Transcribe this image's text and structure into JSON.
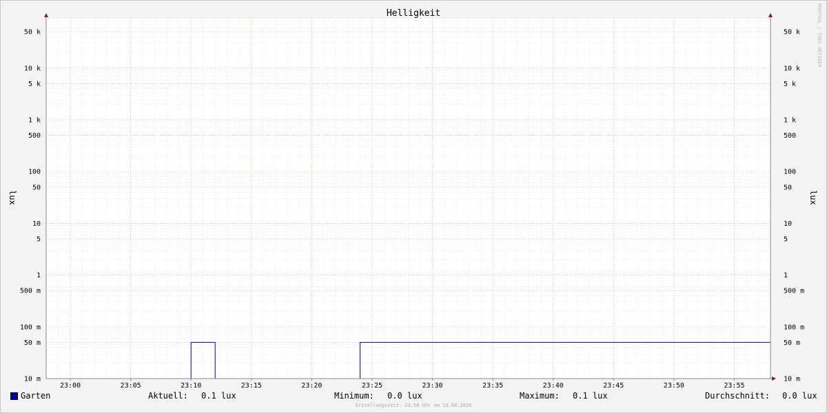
{
  "chart_data": {
    "type": "line",
    "title": "Helligkeit",
    "ylabel": "lux",
    "yscale": "log",
    "ylim": [
      0.01,
      90000
    ],
    "xlim": [
      "22:58",
      "23:58"
    ],
    "x_ticks": [
      "23:00",
      "23:05",
      "23:10",
      "23:15",
      "23:20",
      "23:25",
      "23:30",
      "23:35",
      "23:40",
      "23:45",
      "23:50",
      "23:55"
    ],
    "y_ticks": [
      {
        "value": 50000,
        "label": "50 k"
      },
      {
        "value": 10000,
        "label": "10 k"
      },
      {
        "value": 5000,
        "label": "5 k"
      },
      {
        "value": 1000,
        "label": "1 k"
      },
      {
        "value": 500,
        "label": "500"
      },
      {
        "value": 100,
        "label": "100"
      },
      {
        "value": 50,
        "label": "50"
      },
      {
        "value": 10,
        "label": "10"
      },
      {
        "value": 5,
        "label": "5"
      },
      {
        "value": 1,
        "label": "1"
      },
      {
        "value": 0.5,
        "label": "500 m"
      },
      {
        "value": 0.1,
        "label": "100 m"
      },
      {
        "value": 0.05,
        "label": "50 m"
      },
      {
        "value": 0.01,
        "label": "10 m"
      }
    ],
    "grid": true,
    "series": [
      {
        "name": "Garten",
        "color": "#0000a0",
        "x": [
          "22:58",
          "23:10",
          "23:10",
          "23:12",
          "23:12",
          "23:24",
          "23:24",
          "23:58"
        ],
        "values": [
          0.01,
          0.01,
          0.05,
          0.05,
          0.01,
          0.01,
          0.05,
          0.05
        ]
      }
    ]
  },
  "legend": {
    "series_name": "Garten",
    "current_label": "Aktuell:",
    "current_value": "0.1 lux",
    "min_label": "Minimum:",
    "min_value": "0.0 lux",
    "max_label": "Maximum:",
    "max_value": "0.1 lux",
    "avg_label": "Durchschnitt:",
    "avg_value": "0.0 lux"
  },
  "side_credit": "RRDTOOL / TOBI OETIKER",
  "footer": "Erstellungszeit: 23:58 Uhr am 13.04.2026"
}
